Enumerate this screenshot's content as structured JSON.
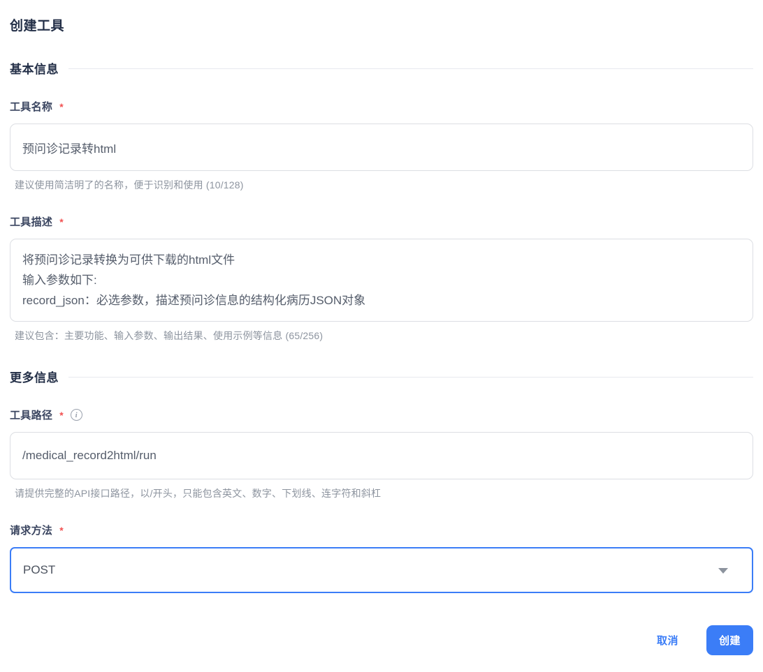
{
  "page": {
    "title": "创建工具"
  },
  "sections": {
    "basic": {
      "title": "基本信息"
    },
    "more": {
      "title": "更多信息"
    }
  },
  "fields": {
    "tool_name": {
      "label": "工具名称",
      "required_mark": "*",
      "value": "预问诊记录转html",
      "hint": "建议使用简洁明了的名称，便于识别和使用 (10/128)"
    },
    "tool_description": {
      "label": "工具描述",
      "required_mark": "*",
      "value": "将预问诊记录转换为可供下载的html文件\n输入参数如下:\nrecord_json：必选参数，描述预问诊信息的结构化病历JSON对象",
      "hint": "建议包含：主要功能、输入参数、输出结果、使用示例等信息 (65/256)"
    },
    "tool_path": {
      "label": "工具路径",
      "required_mark": "*",
      "info_icon": "info-circle",
      "info_glyph": "i",
      "value": "/medical_record2html/run",
      "hint": "请提供完整的API接口路径，以/开头，只能包含英文、数字、下划线、连字符和斜杠"
    },
    "request_method": {
      "label": "请求方法",
      "required_mark": "*",
      "value": "POST",
      "state": "focused"
    }
  },
  "footer": {
    "cancel_label": "取消",
    "create_label": "创建"
  },
  "colors": {
    "accent": "#3b7df7",
    "required": "#f15151",
    "heading": "#232f47",
    "helper_text": "#8d949f",
    "input_border": "#dcdee3"
  }
}
